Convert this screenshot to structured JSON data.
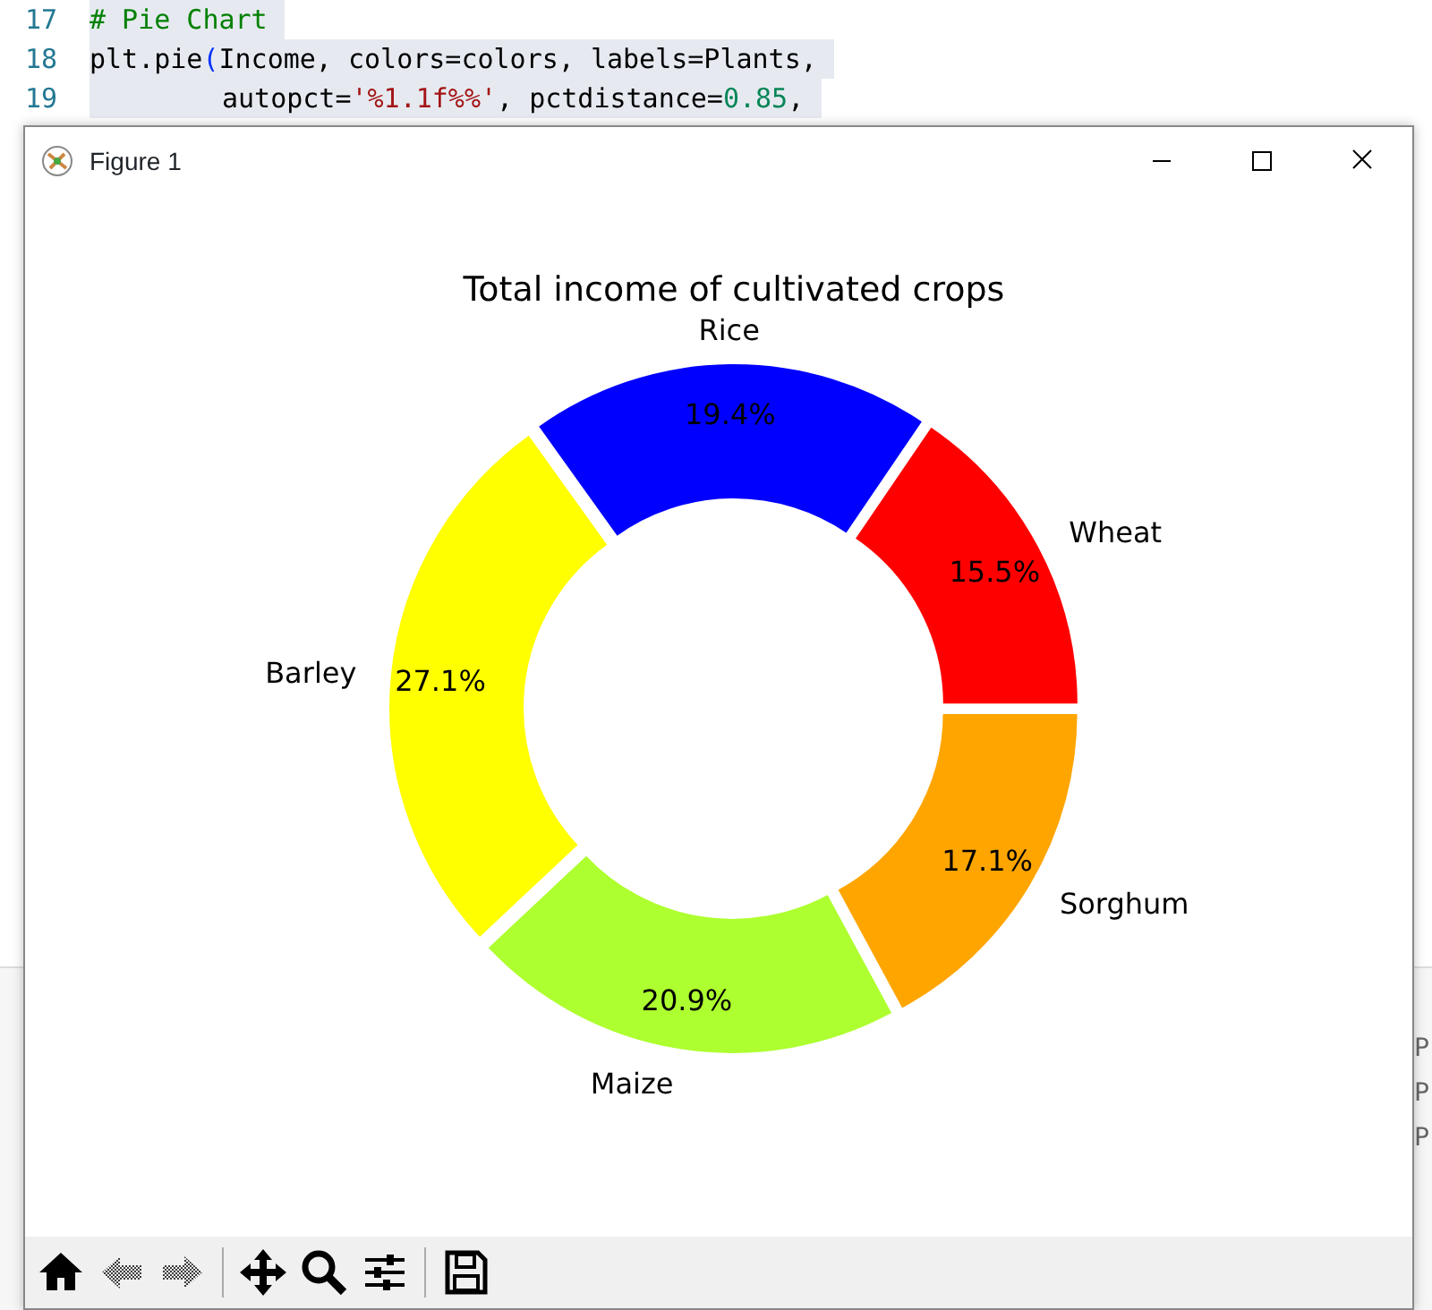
{
  "editor": {
    "lines": [
      {
        "number": "17",
        "indented": false,
        "tokens": [
          {
            "text": "# Pie Chart",
            "kind": "comment"
          }
        ]
      },
      {
        "number": "18",
        "indented": false,
        "tokens": [
          {
            "text": "plt.pie",
            "kind": "plain"
          },
          {
            "text": "(",
            "kind": "paren"
          },
          {
            "text": "Income, colors=colors, labels=Plants,",
            "kind": "plain"
          }
        ]
      },
      {
        "number": "19",
        "indented": true,
        "tokens": [
          {
            "text": "autopct=",
            "kind": "plain"
          },
          {
            "text": "'%1.1f%%'",
            "kind": "string"
          },
          {
            "text": ", pctdistance=",
            "kind": "plain"
          },
          {
            "text": "0.85",
            "kind": "number"
          },
          {
            "text": ",",
            "kind": "plain"
          }
        ]
      }
    ]
  },
  "side_panel": {
    "items": [
      "P",
      "P",
      "P"
    ]
  },
  "window": {
    "title": "Figure 1"
  },
  "chart_data": {
    "type": "donut",
    "title": "Total income of cultivated crops",
    "categories": [
      "Wheat",
      "Rice",
      "Barley",
      "Maize",
      "Sorghum"
    ],
    "values": [
      15.5,
      19.4,
      27.1,
      20.9,
      17.1
    ],
    "value_labels": [
      "15.5%",
      "19.4%",
      "27.1%",
      "20.9%",
      "17.1%"
    ],
    "colors": [
      "#ff0000",
      "#0000ff",
      "#ffff00",
      "#adff2f",
      "#ffa500"
    ]
  },
  "toolbar": [
    {
      "kind": "home",
      "disabled": false
    },
    {
      "kind": "back",
      "disabled": true
    },
    {
      "kind": "forward",
      "disabled": true
    },
    {
      "kind": "sep"
    },
    {
      "kind": "pan",
      "disabled": false
    },
    {
      "kind": "zoom",
      "disabled": false
    },
    {
      "kind": "configure",
      "disabled": false
    },
    {
      "kind": "sep"
    },
    {
      "kind": "save",
      "disabled": false
    }
  ]
}
